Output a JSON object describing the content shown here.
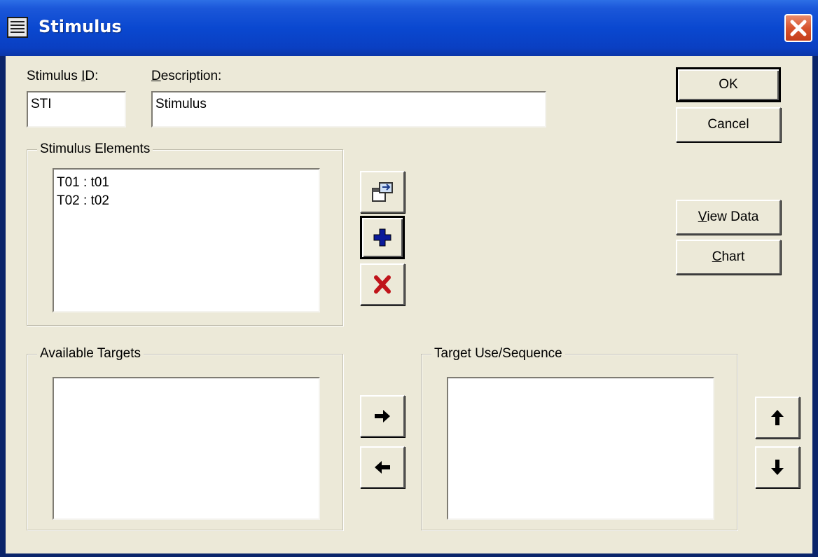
{
  "window": {
    "title": "Stimulus"
  },
  "fields": {
    "stimulus_id_label_pre": "Stimulus ",
    "stimulus_id_label_key": "I",
    "stimulus_id_label_post": "D:",
    "stimulus_id_value": "STI",
    "description_label_key": "D",
    "description_label_post": "escription:",
    "description_value": "Stimulus"
  },
  "buttons": {
    "ok": "OK",
    "cancel": "Cancel",
    "view_data_key": "V",
    "view_data_rest": "iew Data",
    "chart_key": "C",
    "chart_rest": "hart"
  },
  "groups": {
    "stimulus_elements": "Stimulus Elements",
    "available_targets": "Available Targets",
    "target_use_sequence": "Target Use/Sequence"
  },
  "stimulus_elements": [
    "T01 : t01",
    "T02 : t02"
  ],
  "icons": {
    "properties": "properties-icon",
    "add": "plus-icon",
    "delete": "delete-x-icon",
    "move_right": "arrow-right-icon",
    "move_left": "arrow-left-icon",
    "move_up": "arrow-up-icon",
    "move_down": "arrow-down-icon",
    "close": "close-icon"
  },
  "colors": {
    "titlebar": "#0a48d0",
    "close_button": "#d8542e",
    "dialog_face": "#ece9d8",
    "add_icon": "#0a1a9a",
    "delete_icon": "#c0141a"
  }
}
